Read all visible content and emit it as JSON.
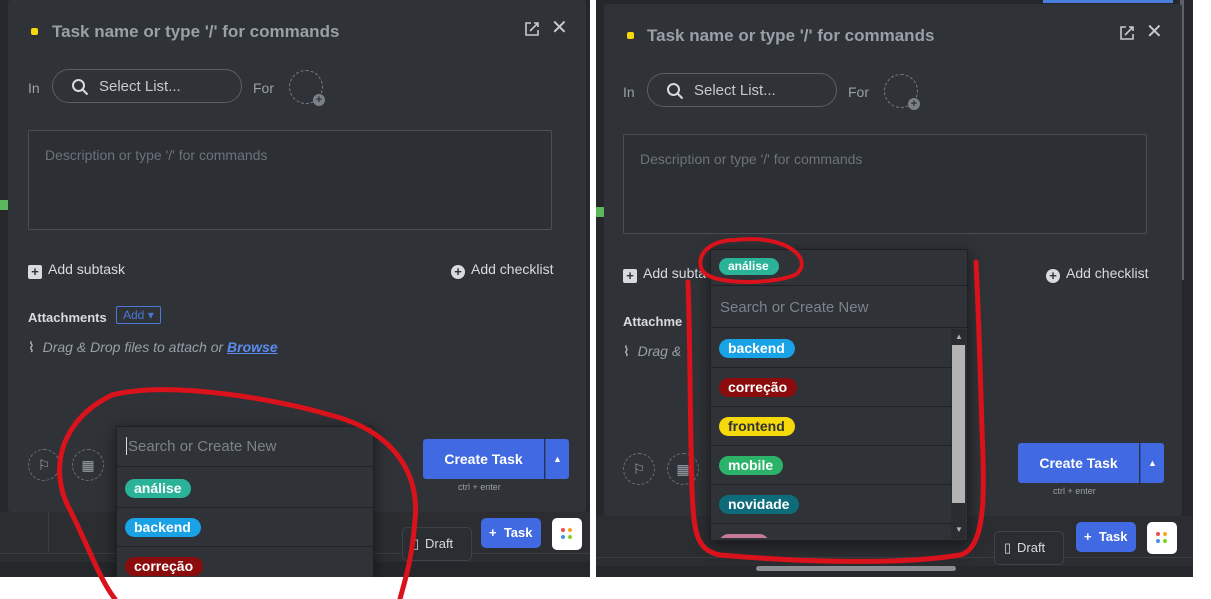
{
  "task_form": {
    "title_placeholder": "Task name or type '/' for commands",
    "in_label": "In",
    "select_list_placeholder": "Select List...",
    "for_label": "For",
    "description_placeholder": "Description or type '/' for commands",
    "add_subtask_label": "Add subtask",
    "add_subtask_label_clipped": "Add subta",
    "add_checklist_label": "Add checklist",
    "attachments_label": "Attachments",
    "attachments_label_clipped": "Attachme",
    "attachments_add_label": "Add",
    "drag_drop_text": "Drag & Drop files to attach or",
    "drag_drop_text_clipped": "Drag &",
    "browse_label": "Browse",
    "create_task_label": "Create Task",
    "create_task_hint": "ctrl + enter",
    "draft_label": "Draft",
    "task_button_label": "Task"
  },
  "tag_dropdown_left": {
    "search_placeholder": "Search or Create New",
    "tags": [
      {
        "name": "análise",
        "color": "#2bb39a"
      },
      {
        "name": "backend",
        "color": "#1aa2e6"
      },
      {
        "name": "correção",
        "color": "#8b0c0c"
      }
    ]
  },
  "tag_dropdown_right": {
    "selected_tag": {
      "name": "análise",
      "color": "#2bb39a"
    },
    "search_placeholder": "Search or Create New",
    "tags": [
      {
        "name": "backend",
        "color": "#1aa2e6",
        "text_color": "#ffffff"
      },
      {
        "name": "correção",
        "color": "#8b0c0c",
        "text_color": "#ffffff"
      },
      {
        "name": "frontend",
        "color": "#f5d90a",
        "text_color": "#2f3236"
      },
      {
        "name": "mobile",
        "color": "#2bb36a",
        "text_color": "#ffffff"
      },
      {
        "name": "novidade",
        "color": "#0e6b7a",
        "text_color": "#ffffff"
      }
    ],
    "partial_tag_color": "#c57a9a"
  },
  "colors": {
    "accent": "#4169e1",
    "annotation": "#d9121c",
    "background": "#25272b",
    "modal": "#2f3236",
    "title_dot": "#f5d90a"
  }
}
